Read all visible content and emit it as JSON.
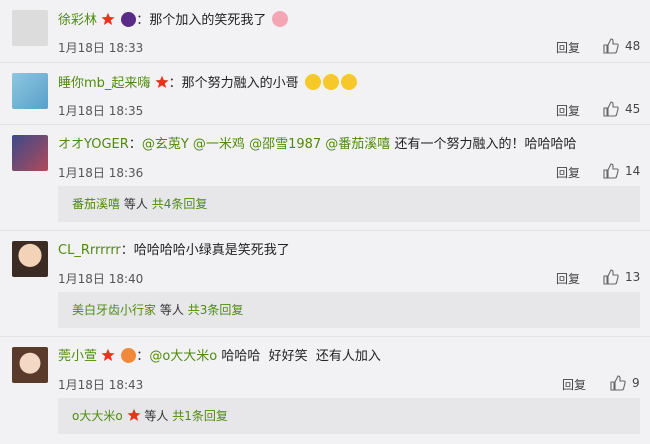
{
  "comments": [
    {
      "username": "徐彩林",
      "sep": "：",
      "text": "那个加入的笑死我了",
      "time": "1月18日 18:33",
      "reply": "回复",
      "likes": "48"
    },
    {
      "username": "睡你mb_起来嗨",
      "sep": "：",
      "text": "那个努力融入的小哥",
      "time": "1月18日 18:35",
      "reply": "回复",
      "likes": "45"
    },
    {
      "username": "オオYOGER",
      "sep": "：",
      "mentions": [
        "@玄莵Y",
        "@一米鸡",
        "@邵雪1987",
        "@番茄溪嘻"
      ],
      "text": "还有一个努力融入的！哈哈哈哈",
      "time": "1月18日 18:36",
      "reply": "回复",
      "likes": "14",
      "sub": {
        "name": "番茄溪嘻",
        "middle": "等人",
        "total": "共4条回复"
      }
    },
    {
      "username": "CL_Rrrrrrr",
      "sep": "：",
      "text": "哈哈哈哈小绿真是笑死我了",
      "time": "1月18日 18:40",
      "reply": "回复",
      "likes": "13",
      "sub": {
        "name": "美白牙齿小行家",
        "middle": "等人",
        "total": "共3条回复"
      }
    },
    {
      "username": "莞小萱",
      "sep": "：",
      "mention": "@o大大米o",
      "text": "哈哈哈  好好笑  还有人加入",
      "time": "1月18日 18:43",
      "reply": "回复",
      "likes": "9",
      "sub": {
        "name": "o大大米o",
        "middle": "等人",
        "total": "共1条回复"
      }
    }
  ],
  "colors": {
    "accent": "#4f8a10",
    "star": "#e8341c",
    "background": "#f2f2f5",
    "subpanel": "#e7e7ea"
  },
  "icons": {
    "member_badge": "star-badge-icon",
    "like": "thumb-up-icon"
  }
}
